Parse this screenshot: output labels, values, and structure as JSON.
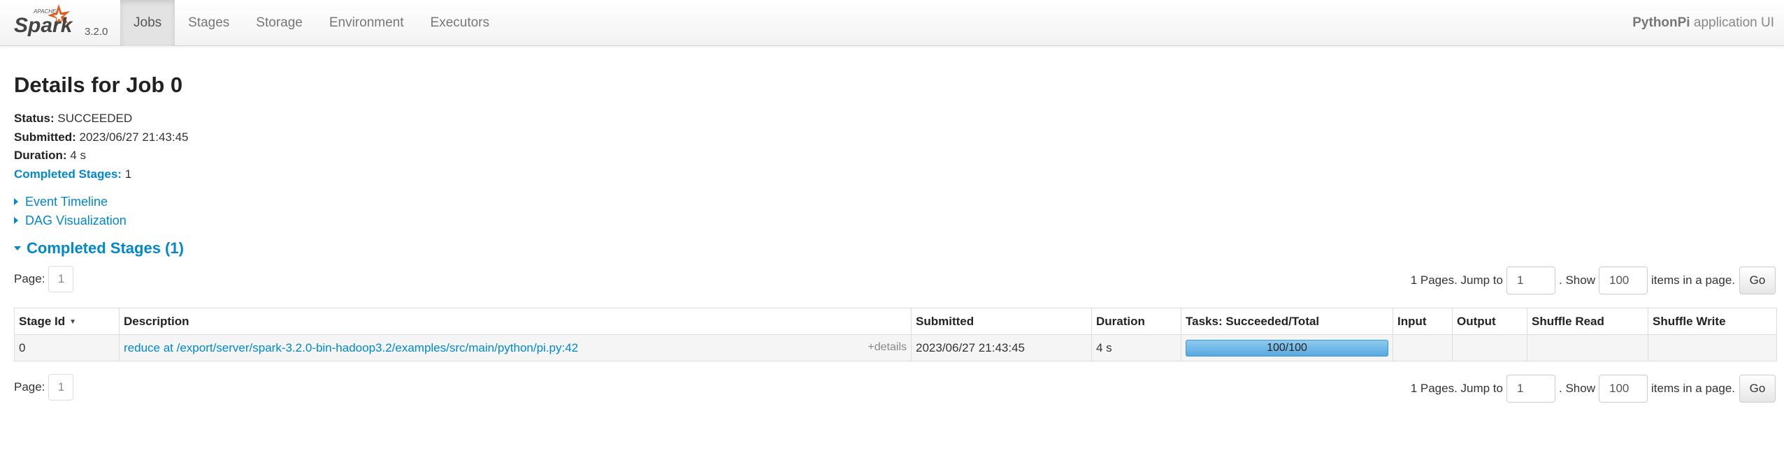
{
  "brand": {
    "apache": "APACHE",
    "logo": "Spark",
    "version": "3.2.0"
  },
  "nav": {
    "items": [
      {
        "label": "Jobs",
        "active": true
      },
      {
        "label": "Stages"
      },
      {
        "label": "Storage"
      },
      {
        "label": "Environment"
      },
      {
        "label": "Executors"
      }
    ],
    "app_name": "PythonPi",
    "app_suffix": " application UI"
  },
  "page": {
    "title": "Details for Job 0",
    "summary": {
      "status_label": "Status:",
      "status": "SUCCEEDED",
      "submitted_label": "Submitted:",
      "submitted": "2023/06/27 21:43:45",
      "duration_label": "Duration:",
      "duration": "4 s",
      "completed_label": "Completed Stages:",
      "completed": "1"
    },
    "event_timeline": "Event Timeline",
    "dag_visualization": "DAG Visualization",
    "section_title": "Completed Stages (1)"
  },
  "pager": {
    "page_label": "Page:",
    "page": "1",
    "pages_text": "1 Pages. Jump to",
    "jump_value": "1",
    "show_text": ". Show",
    "show_value": "100",
    "items_text": "items in a page.",
    "go": "Go"
  },
  "table": {
    "headers": {
      "stage_id": "Stage Id",
      "description": "Description",
      "submitted": "Submitted",
      "duration": "Duration",
      "tasks": "Tasks: Succeeded/Total",
      "input": "Input",
      "output": "Output",
      "shuffle_read": "Shuffle Read",
      "shuffle_write": "Shuffle Write"
    },
    "sort_icon": "triangle-down",
    "rows": [
      {
        "stage_id": "0",
        "description": "reduce at /export/server/spark-3.2.0-bin-hadoop3.2/examples/src/main/python/pi.py:42",
        "details": "+details",
        "submitted": "2023/06/27 21:43:45",
        "duration": "4 s",
        "tasks": "100/100",
        "tasks_fraction": 1.0,
        "input": "",
        "output": "",
        "shuffle_read": "",
        "shuffle_write": ""
      }
    ]
  },
  "colors": {
    "link": "#0088cc",
    "progress": "#5aa9df"
  }
}
